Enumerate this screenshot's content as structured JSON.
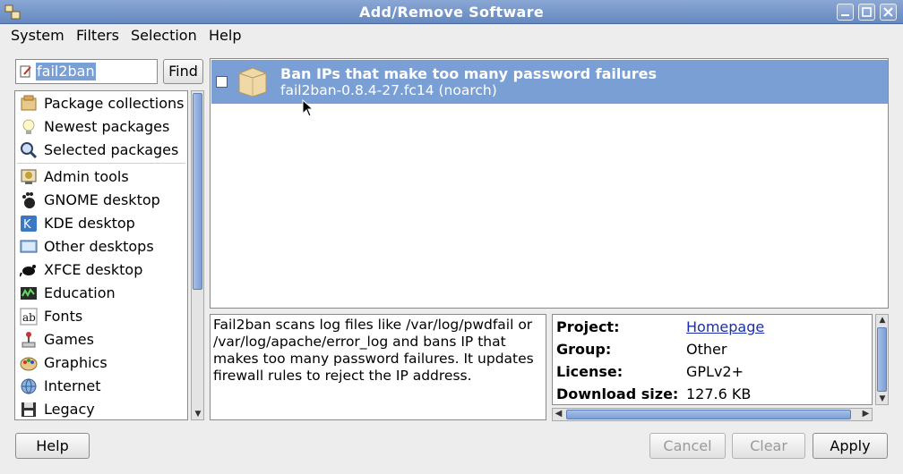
{
  "window": {
    "title": "Add/Remove Software",
    "titlebar_color": "#6f90c6"
  },
  "menu": [
    "System",
    "Filters",
    "Selection",
    "Help"
  ],
  "search": {
    "value": "fail2ban",
    "find_label": "Find"
  },
  "sidebar": {
    "items": [
      {
        "label": "Package collections",
        "icon": "package-collections-icon"
      },
      {
        "label": "Newest packages",
        "icon": "lightbulb-icon"
      },
      {
        "label": "Selected packages",
        "icon": "magnifier-icon"
      },
      {
        "label": "Admin tools",
        "icon": "admin-tools-icon"
      },
      {
        "label": "GNOME desktop",
        "icon": "gnome-foot-icon"
      },
      {
        "label": "KDE desktop",
        "icon": "kde-icon"
      },
      {
        "label": "Other desktops",
        "icon": "other-desktops-icon"
      },
      {
        "label": "XFCE desktop",
        "icon": "xfce-mouse-icon"
      },
      {
        "label": "Education",
        "icon": "education-icon"
      },
      {
        "label": "Fonts",
        "icon": "fonts-icon"
      },
      {
        "label": "Games",
        "icon": "games-joystick-icon"
      },
      {
        "label": "Graphics",
        "icon": "graphics-palette-icon"
      },
      {
        "label": "Internet",
        "icon": "globe-icon"
      },
      {
        "label": "Legacy",
        "icon": "legacy-floppy-icon"
      }
    ]
  },
  "packages": [
    {
      "summary": "Ban IPs that make too many password failures",
      "name": "fail2ban-0.8.4-27.fc14 (noarch)",
      "checked": false,
      "selected_color": "#7a9fd4"
    }
  ],
  "description": {
    "text": "Fail2ban scans log files like /var/log/pwdfail or /var/log/apache/error_log and bans IP that makes too many password failures. It updates firewall rules to reject the IP address."
  },
  "details": {
    "rows": [
      {
        "key": "Project:",
        "value": "Homepage",
        "link": true
      },
      {
        "key": "Group:",
        "value": "Other",
        "link": false
      },
      {
        "key": "License:",
        "value": "GPLv2+",
        "link": false
      },
      {
        "key": "Download size:",
        "value": "127.6 KB",
        "link": false
      }
    ]
  },
  "buttons": {
    "help": "Help",
    "cancel": "Cancel",
    "clear": "Clear",
    "apply": "Apply"
  }
}
